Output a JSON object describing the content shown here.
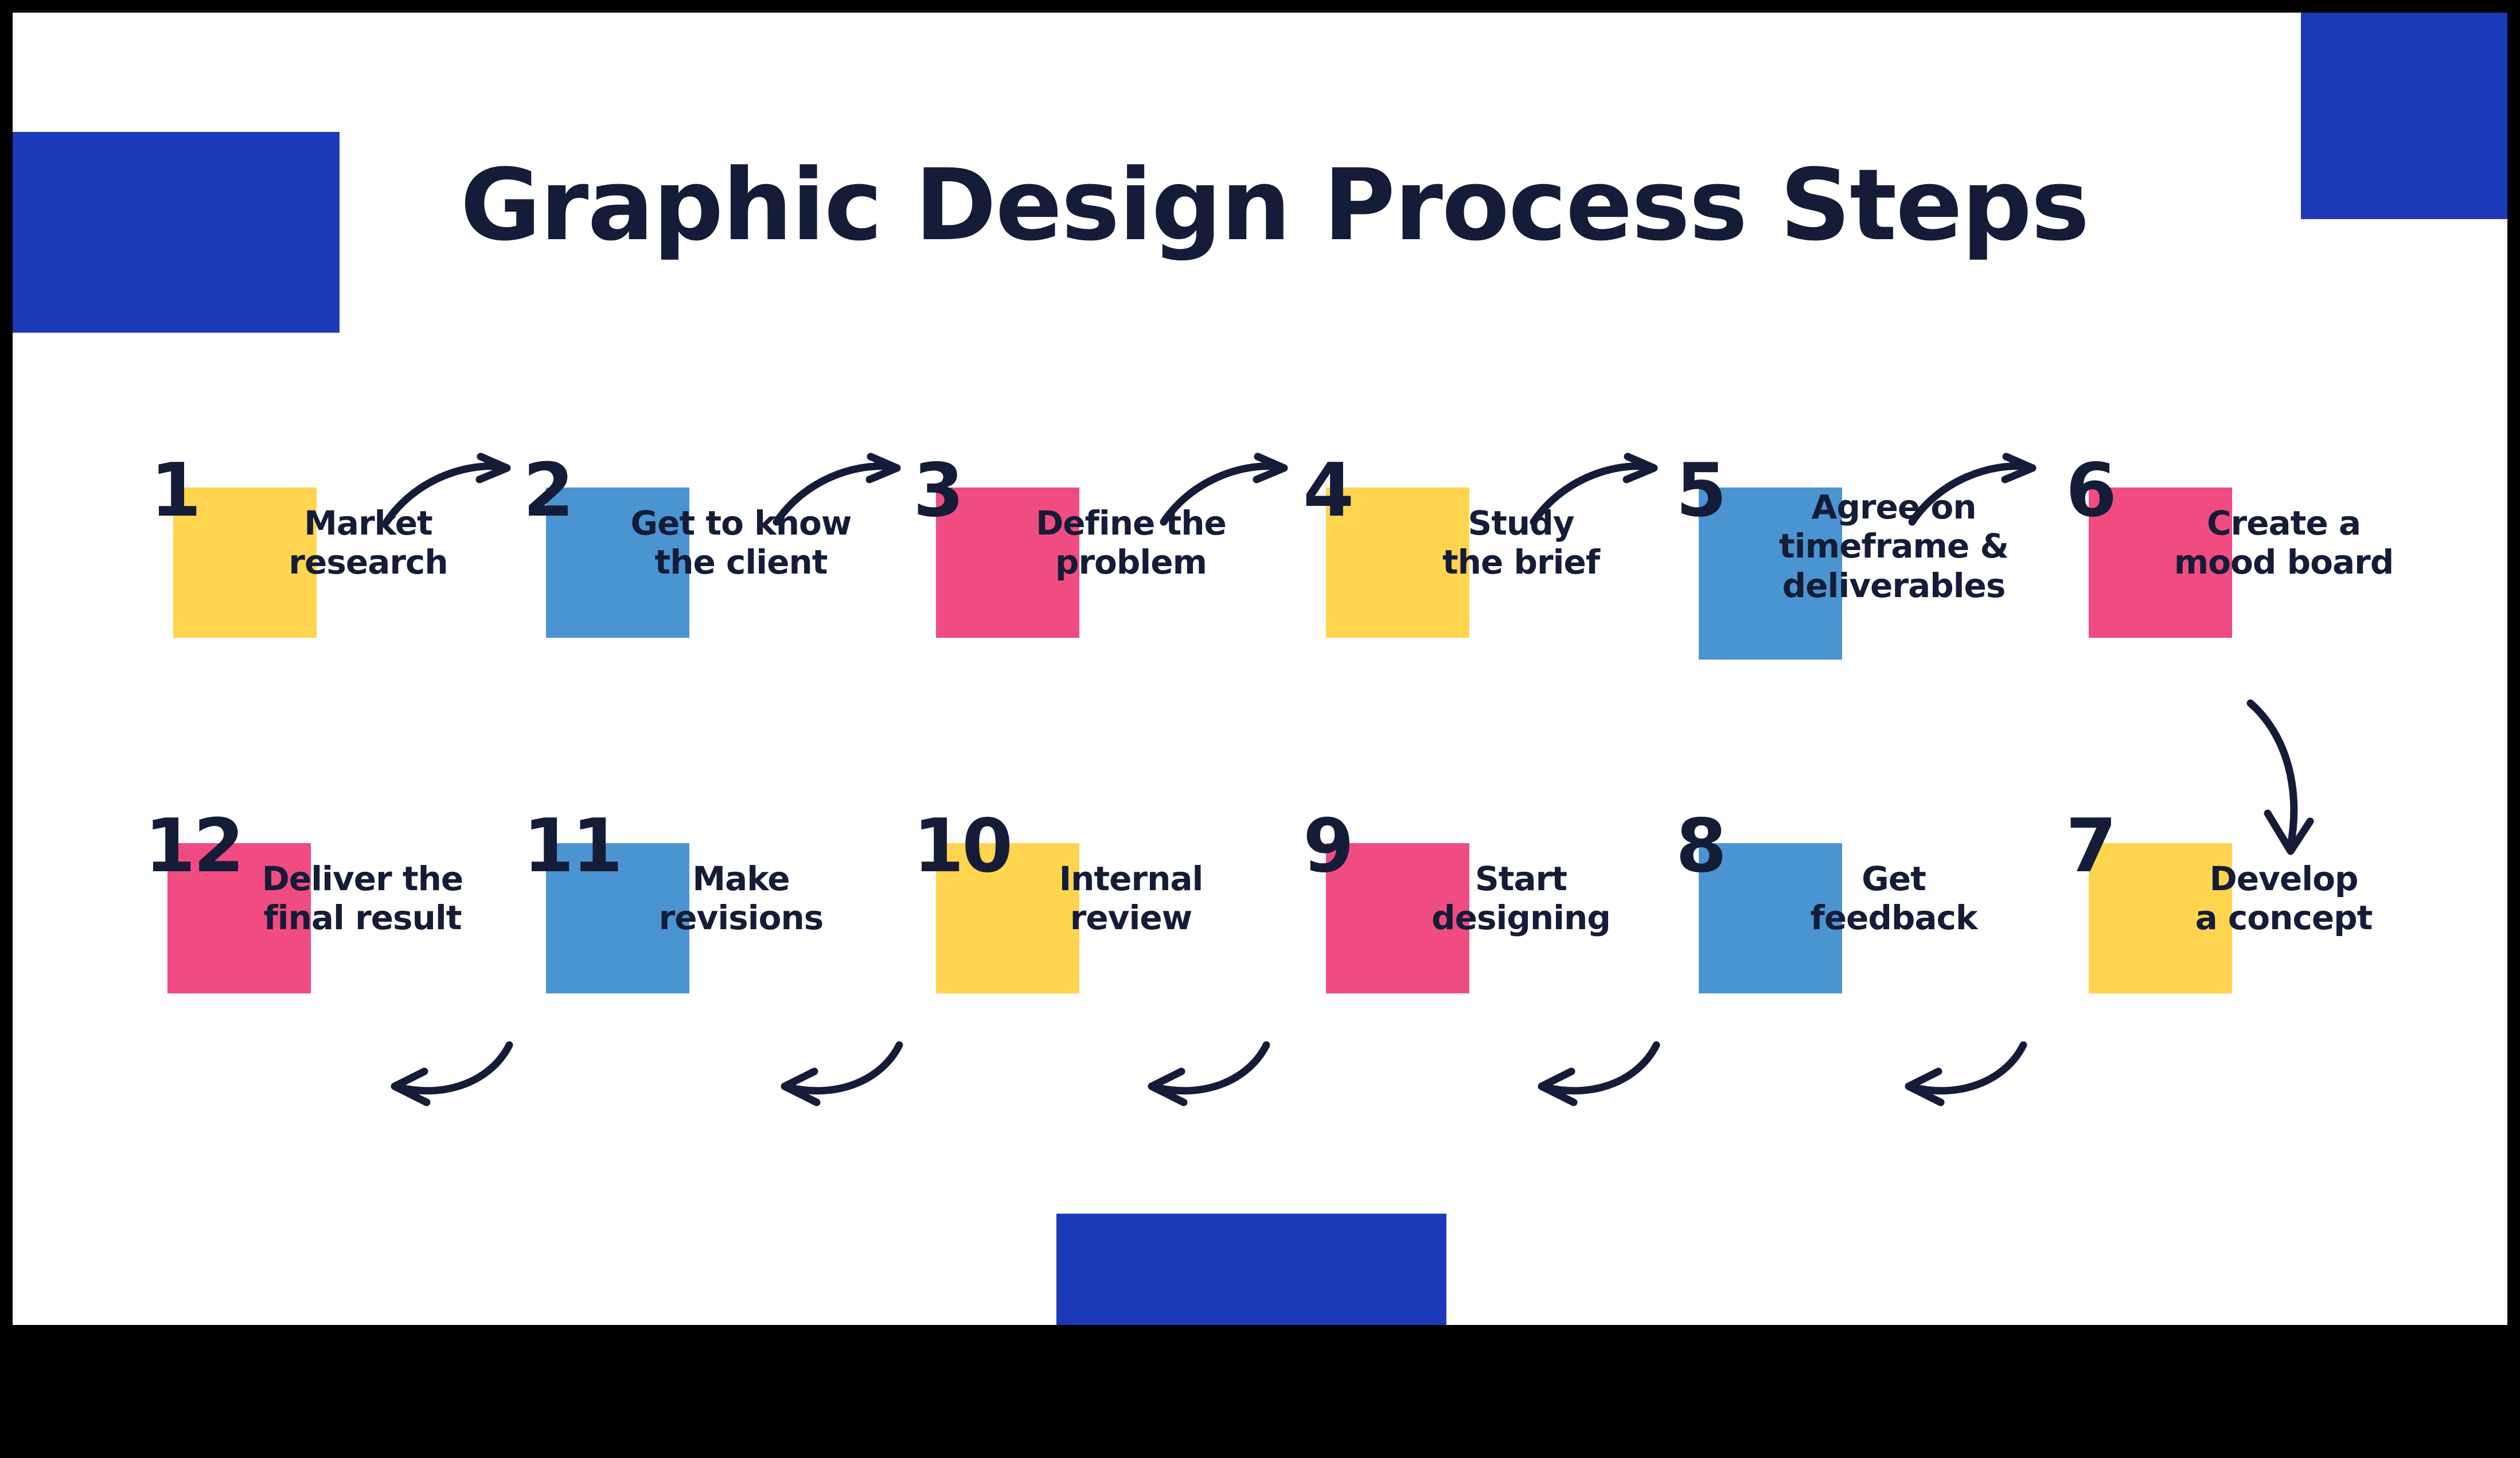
{
  "title": "Graphic Design Process Steps",
  "colors": {
    "frame": "#000000",
    "canvas": "#ffffff",
    "royal_blue": "#1b39b8",
    "yellow": "#ffd44e",
    "light_blue": "#4a95d1",
    "pink": "#f04c81",
    "ink": "#151c38"
  },
  "decor": [
    {
      "name": "top-left-blue-block"
    },
    {
      "name": "top-right-blue-block"
    },
    {
      "name": "bottom-blue-block"
    }
  ],
  "steps": [
    {
      "number": "1",
      "label": "Market\nresearch",
      "color": "yellow",
      "row": 1
    },
    {
      "number": "2",
      "label": "Get to know\nthe client",
      "color": "blue",
      "row": 1
    },
    {
      "number": "3",
      "label": "Define the\nproblem",
      "color": "pink",
      "row": 1
    },
    {
      "number": "4",
      "label": "Study\nthe brief",
      "color": "yellow",
      "row": 1
    },
    {
      "number": "5",
      "label": "Agree on\ntimeframe &\ndeliverables",
      "color": "blue",
      "row": 1
    },
    {
      "number": "6",
      "label": "Create a\nmood board",
      "color": "pink",
      "row": 1
    },
    {
      "number": "12",
      "label": "Deliver the\nfinal result",
      "color": "pink",
      "row": 2
    },
    {
      "number": "11",
      "label": "Make\nrevisions",
      "color": "blue",
      "row": 2
    },
    {
      "number": "10",
      "label": "Internal\nreview",
      "color": "yellow",
      "row": 2
    },
    {
      "number": "9",
      "label": "Start\ndesigning",
      "color": "pink",
      "row": 2
    },
    {
      "number": "8",
      "label": "Get\nfeedback",
      "color": "blue",
      "row": 2
    },
    {
      "number": "7",
      "label": "Develop\na concept",
      "color": "yellow",
      "row": 2
    }
  ],
  "arrows": [
    {
      "name": "arrow-1-to-2",
      "direction": "right"
    },
    {
      "name": "arrow-2-to-3",
      "direction": "right"
    },
    {
      "name": "arrow-3-to-4",
      "direction": "right"
    },
    {
      "name": "arrow-4-to-5",
      "direction": "right"
    },
    {
      "name": "arrow-5-to-6",
      "direction": "right"
    },
    {
      "name": "arrow-6-to-7",
      "direction": "down"
    },
    {
      "name": "arrow-8-to-7",
      "direction": "left"
    },
    {
      "name": "arrow-9-to-8",
      "direction": "left"
    },
    {
      "name": "arrow-10-to-9",
      "direction": "left"
    },
    {
      "name": "arrow-11-to-10",
      "direction": "left"
    },
    {
      "name": "arrow-12-to-11",
      "direction": "left"
    }
  ]
}
